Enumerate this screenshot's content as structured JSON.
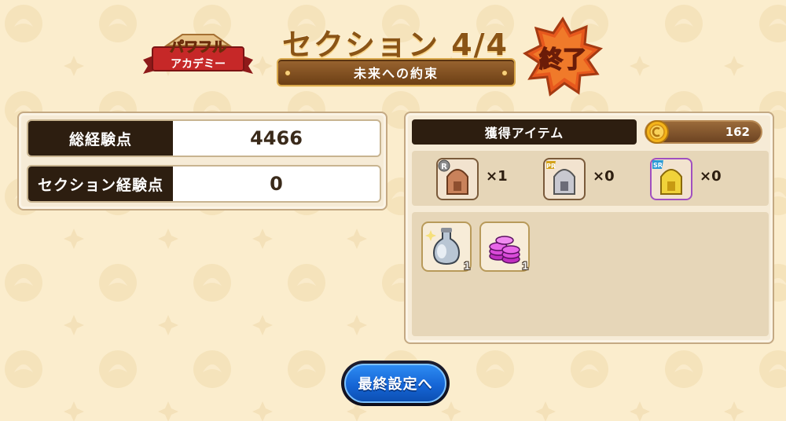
{
  "header": {
    "logo_text_line1": "パワフル",
    "logo_text_line2": "アカデミー",
    "section_title": "セクション 4/4",
    "subtitle": "未来への約束",
    "end_badge_text": "終了"
  },
  "stats": {
    "total_exp_label": "総経験点",
    "total_exp_value": "4466",
    "section_exp_label": "セクション経験点",
    "section_exp_value": "0"
  },
  "items": {
    "header_label": "獲得アイテム",
    "coin_count": "162",
    "helmets": [
      {
        "rarity": "R",
        "count": "×1",
        "color": "#c9825b"
      },
      {
        "rarity": "SR",
        "count": "×0",
        "color": "#b8b8c2"
      },
      {
        "rarity": "SR",
        "count": "×0",
        "color": "#e8c83a"
      }
    ],
    "rewards": [
      {
        "icon": "silver-potion-icon",
        "qty": "1"
      },
      {
        "icon": "pink-coins-icon",
        "qty": "1"
      }
    ]
  },
  "button": {
    "final_label": "最終設定へ"
  },
  "colors": {
    "background": "#fbedcd",
    "dark_label": "#2d1e10",
    "title_brown": "#8a5416",
    "button_blue": "#1666d6"
  }
}
